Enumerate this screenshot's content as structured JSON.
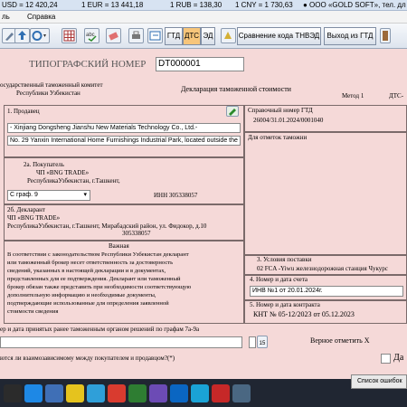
{
  "rates": {
    "usd": "USD = 12 420,24",
    "eur": "1 EUR = 13 441,18",
    "rub": "1 RUB = 138,30",
    "cny": "1 CNY = 1 730,63",
    "company": "● ООО «GOLD SOFT», тел. дл"
  },
  "menu": {
    "left": "ль",
    "help": "Справка"
  },
  "toolbar": {
    "btn_gtd": "ГТД",
    "btn_dts": "ДТС",
    "btn_ed": "ЭД",
    "btn_compare": "Сравнение кода ТНВЭД",
    "btn_exit": "Выход из ГТД"
  },
  "doc": {
    "header_title": "ТИПОГРАФСКИЙ НОМЕР",
    "header_number": "DT000001",
    "committee_line1": "осударственный таможенный комитет",
    "committee_line2": "Республики Узбекистан",
    "declaration_title": "Декларация таможенной стоимости",
    "method": "Метод 1",
    "dts_prefix": "ДТС-",
    "seller_label": "1. Продавец",
    "seller_name": "- Xinjiang Dongsheng Jianshu New Materials Technology Co., Ltd.-",
    "seller_address": "No. 29 Yanxin International Home Furnishings Industrial Park, located outside the",
    "ref_label": "Справочный номер ГТД",
    "ref_value": "26004/31.01.2024/0001040",
    "customs_note": "Для отметок таможни",
    "buyer_label": "2а. Покупатель",
    "buyer_name": "ЧП «BNG TRADE»",
    "buyer_address": "РеспубликаУзбекистан, г.Ташкент,",
    "graf_value": "С граф. 9",
    "inn": "ИНН 305338057",
    "declarant_label": "2б. Декларант",
    "declarant_name": "ЧП «BNG TRADE»",
    "declarant_address": "РеспубликаУзбекистан, г.Ташкент, Мирабадский район, ул. Фидокор, д.10",
    "declarant_inn": "305338057",
    "important_title": "Важная",
    "important_text": [
      "В соответствии с законодательством Республики Узбекистан декларант",
      "или таможенный брокер несет ответственность за достоверность",
      "сведений, указанных в настоящей декларации и в документах,",
      "представленных для ее подтверждения. Декларант или таможенный",
      "брокер обязан также представить при необходимости соответствующую",
      "дополнительную информацию и необходимые документы,",
      "подтверждающие использованные для определения заявленной",
      "стоимости сведения"
    ],
    "delivery_label": "3. Условия поставки",
    "delivery_value": "02 FCA -Yiwu железнодорожная станция Чукурс",
    "invoice_label": "4. Номер и дата счета",
    "invoice_value": "ИНВ №1 от 20.01.2024г.",
    "contract_label": "5. Номер и дата контракта",
    "contract_value": "КНТ № 05-12/2023 от 05.12.2023",
    "prev_decision": "ер и дата принятых ранее таможенным органом решений по графам 7а-9а",
    "date_icon": "15",
    "mark_x": "Верное отметить X",
    "related_question": "ются ли взаимозависимому между покупателем и продавцом?(*)",
    "yes_label": "Да"
  },
  "taskbar": {
    "error_list": "Список ошибок"
  }
}
